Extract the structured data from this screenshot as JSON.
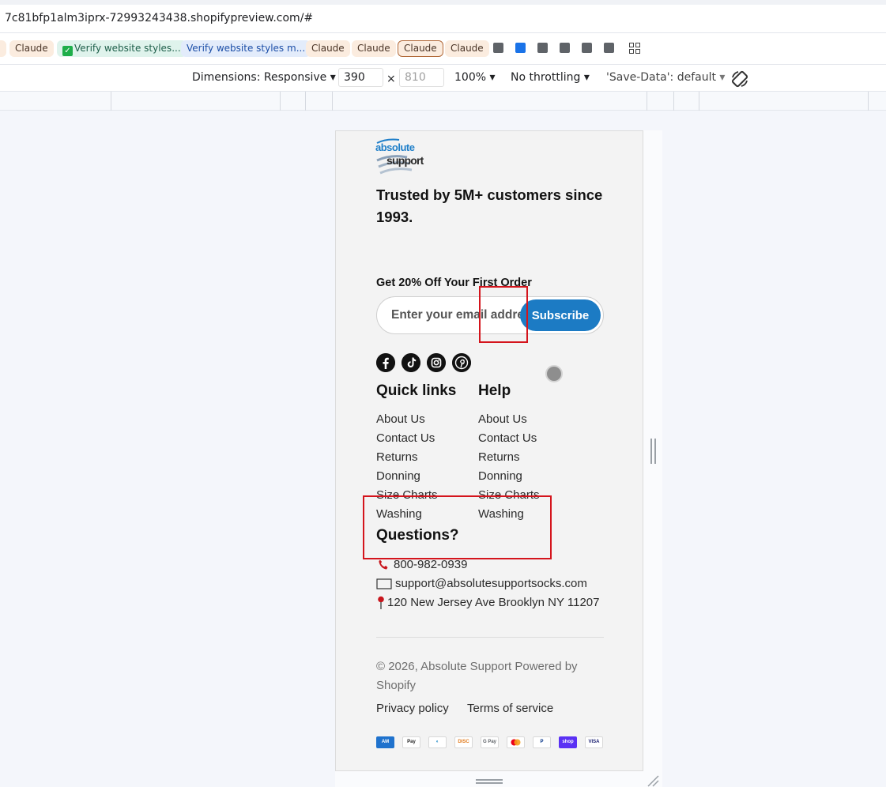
{
  "browser": {
    "url": "7c81bfp1alm3iprx-72993243438.shopifypreview.com/#",
    "bookmarks": [
      {
        "label": "Claude",
        "style": "claude"
      },
      {
        "label": "Verify website styles...",
        "style": "green"
      },
      {
        "label": "Verify website styles m...",
        "style": "blue"
      },
      {
        "label": "Claude",
        "style": "claude"
      },
      {
        "label": "Claude",
        "style": "claude"
      },
      {
        "label": "Claude",
        "style": "claude-outlined"
      },
      {
        "label": "Claude",
        "style": "claude"
      }
    ]
  },
  "device_toolbar": {
    "dimensions_label": "Dimensions: Responsive",
    "width_value": "390",
    "height_placeholder": "810",
    "zoom_label": "100%",
    "throttling_label": "No throttling",
    "save_data_label": "'Save-Data': default"
  },
  "footer": {
    "logo_text_top": "absolute",
    "logo_text_bottom": "support",
    "tagline": "Trusted by 5M+ customers since 1993.",
    "newsletter": {
      "title": "Get 20% Off Your First Order",
      "email_placeholder": "Enter your email address",
      "subscribe_label": "Subscribe"
    },
    "socials": [
      "facebook-icon",
      "tiktok-icon",
      "instagram-icon",
      "pinterest-icon"
    ],
    "quick_links": {
      "heading": "Quick links",
      "items": [
        "About Us",
        "Contact Us",
        "Returns",
        "Donning",
        "Size Charts",
        "Washing"
      ]
    },
    "help": {
      "heading": "Help",
      "items": [
        "About Us",
        "Contact Us",
        "Returns",
        "Donning",
        "Size Charts",
        "Washing"
      ]
    },
    "questions": {
      "heading": "Questions?",
      "phone": "800-982-0939",
      "email": "support@absolutesupportsocks.com",
      "address": "120 New Jersey Ave Brooklyn NY 11207"
    },
    "copyright": "© 2026, Absolute Support Powered by Shopify",
    "policies": [
      "Privacy policy",
      "Terms of service"
    ],
    "payment_methods": [
      "American Express",
      "Apple Pay",
      "Diners Club",
      "Discover",
      "Google Pay",
      "Mastercard",
      "PayPal",
      "Shop Pay",
      "Visa"
    ]
  },
  "colors": {
    "accent": "#1c7bc4",
    "annotation": "#d4141c",
    "background": "#f3f3f3"
  }
}
